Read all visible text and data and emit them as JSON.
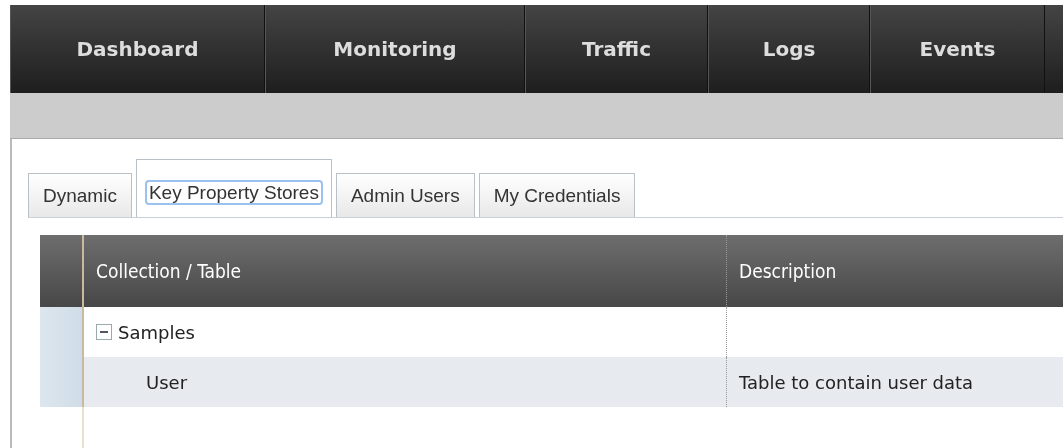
{
  "nav": {
    "items": [
      {
        "label": "Dashboard"
      },
      {
        "label": "Monitoring"
      },
      {
        "label": "Traffic"
      },
      {
        "label": "Logs"
      },
      {
        "label": "Events"
      }
    ]
  },
  "tabs": [
    {
      "label": "Dynamic",
      "selected": false
    },
    {
      "label": "Key Property Stores",
      "selected": true
    },
    {
      "label": "Admin Users",
      "selected": false
    },
    {
      "label": "My Credentials",
      "selected": false
    }
  ],
  "table": {
    "columns": [
      "Collection / Table",
      "Description"
    ],
    "rows": [
      {
        "name": "Samples",
        "description": "",
        "expanded": true,
        "children": [
          {
            "name": "User",
            "description": "Table to contain user data"
          }
        ]
      }
    ]
  }
}
